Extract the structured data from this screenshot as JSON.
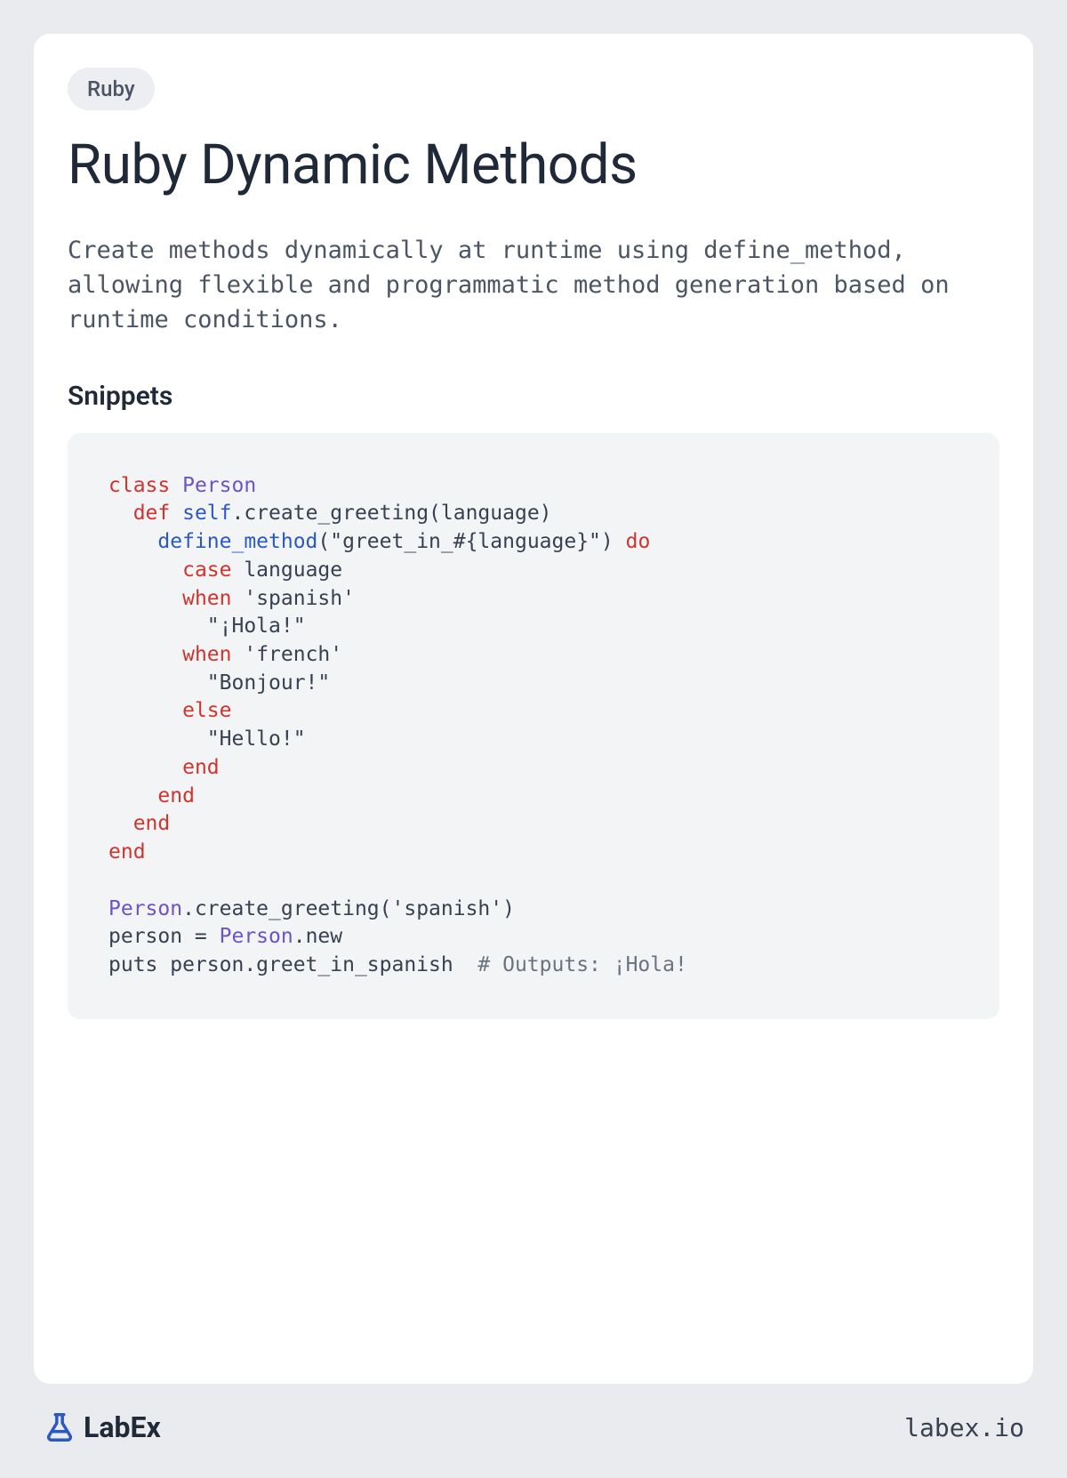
{
  "badge": "Ruby",
  "title": "Ruby Dynamic Methods",
  "description": "Create methods dynamically at runtime using define_method, allowing flexible and programmatic method generation based on runtime conditions.",
  "section_heading": "Snippets",
  "code": {
    "tokens": [
      {
        "t": "class ",
        "c": "kw"
      },
      {
        "t": "Person",
        "c": "cls"
      },
      {
        "t": "\n"
      },
      {
        "t": "  "
      },
      {
        "t": "def ",
        "c": "kw"
      },
      {
        "t": "self",
        "c": "fn"
      },
      {
        "t": ".create_greeting(language)\n"
      },
      {
        "t": "    "
      },
      {
        "t": "define_method",
        "c": "fn"
      },
      {
        "t": "("
      },
      {
        "t": "\"greet_in_#{language}\"",
        "c": "str"
      },
      {
        "t": ") "
      },
      {
        "t": "do",
        "c": "kw"
      },
      {
        "t": "\n"
      },
      {
        "t": "      "
      },
      {
        "t": "case",
        "c": "kw"
      },
      {
        "t": " language\n"
      },
      {
        "t": "      "
      },
      {
        "t": "when",
        "c": "kw"
      },
      {
        "t": " "
      },
      {
        "t": "'spanish'",
        "c": "str"
      },
      {
        "t": "\n"
      },
      {
        "t": "        "
      },
      {
        "t": "\"¡Hola!\"",
        "c": "str"
      },
      {
        "t": "\n"
      },
      {
        "t": "      "
      },
      {
        "t": "when",
        "c": "kw"
      },
      {
        "t": " "
      },
      {
        "t": "'french'",
        "c": "str"
      },
      {
        "t": "\n"
      },
      {
        "t": "        "
      },
      {
        "t": "\"Bonjour!\"",
        "c": "str"
      },
      {
        "t": "\n"
      },
      {
        "t": "      "
      },
      {
        "t": "else",
        "c": "kw"
      },
      {
        "t": "\n"
      },
      {
        "t": "        "
      },
      {
        "t": "\"Hello!\"",
        "c": "str"
      },
      {
        "t": "\n"
      },
      {
        "t": "      "
      },
      {
        "t": "end",
        "c": "kw"
      },
      {
        "t": "\n"
      },
      {
        "t": "    "
      },
      {
        "t": "end",
        "c": "kw"
      },
      {
        "t": "\n"
      },
      {
        "t": "  "
      },
      {
        "t": "end",
        "c": "kw"
      },
      {
        "t": "\n"
      },
      {
        "t": "end",
        "c": "kw"
      },
      {
        "t": "\n"
      },
      {
        "t": "\n"
      },
      {
        "t": "Person",
        "c": "cls"
      },
      {
        "t": ".create_greeting("
      },
      {
        "t": "'spanish'",
        "c": "str"
      },
      {
        "t": ")\n"
      },
      {
        "t": "person = "
      },
      {
        "t": "Person",
        "c": "cls"
      },
      {
        "t": ".new\n"
      },
      {
        "t": "puts person.greet_in_spanish  "
      },
      {
        "t": "# Outputs: ¡Hola!",
        "c": "cmt"
      }
    ]
  },
  "footer": {
    "brand": "LabEx",
    "url": "labex.io"
  }
}
